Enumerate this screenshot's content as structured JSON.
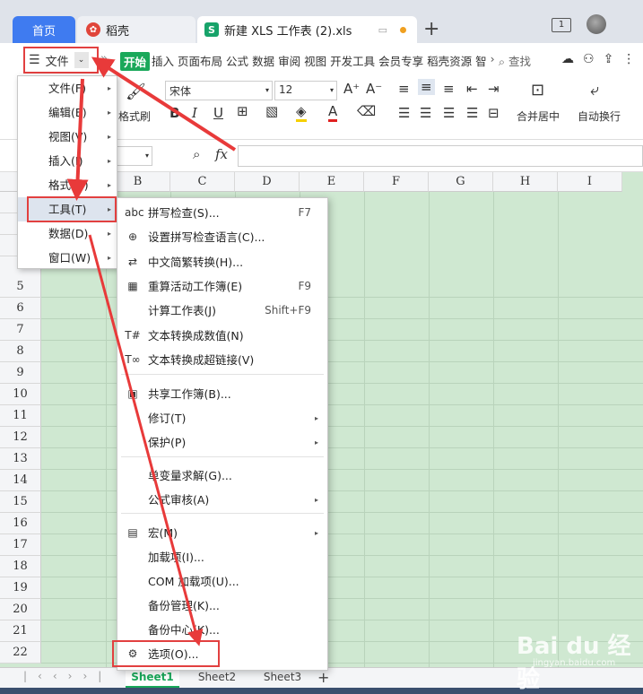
{
  "tabs": {
    "home": "首页",
    "daoke": "稻壳",
    "doc": "新建 XLS 工作表 (2).xls"
  },
  "menubar": {
    "file": "文件",
    "start": "开始",
    "tabs": [
      "插入",
      "页面布局",
      "公式",
      "数据",
      "审阅",
      "视图",
      "开发工具",
      "会员专享",
      "稻壳资源",
      "智"
    ],
    "search": "查找"
  },
  "ribbon": {
    "format_brush": "格式刷",
    "font": "宋体",
    "size": "12",
    "merge": "合并居中",
    "wrap": "自动换行"
  },
  "formula": {
    "fx": "fx"
  },
  "columns": [
    "B",
    "C",
    "D",
    "E",
    "F",
    "G",
    "H",
    "I"
  ],
  "rows": [
    "5",
    "6",
    "7",
    "8",
    "9",
    "10",
    "11",
    "12",
    "13",
    "14",
    "15",
    "16",
    "17",
    "18",
    "19",
    "20",
    "21",
    "22"
  ],
  "sheets": [
    "Sheet1",
    "Sheet2",
    "Sheet3"
  ],
  "menu1": [
    {
      "label": "文件(F)"
    },
    {
      "label": "编辑(E)"
    },
    {
      "label": "视图(V)"
    },
    {
      "label": "插入(I)"
    },
    {
      "label": "格式(O)"
    },
    {
      "label": "工具(T)"
    },
    {
      "label": "数据(D)"
    },
    {
      "label": "窗口(W)"
    }
  ],
  "menu2": [
    {
      "label": "拼写检查(S)...",
      "sc": "F7",
      "icon": "abc"
    },
    {
      "label": "设置拼写检查语言(C)...",
      "sc": "",
      "icon": "⊕"
    },
    {
      "label": "中文简繁转换(H)...",
      "sc": "",
      "icon": "⇄"
    },
    {
      "label": "重算活动工作簿(E)",
      "sc": "F9",
      "icon": "▦"
    },
    {
      "label": "计算工作表(J)",
      "sc": "Shift+F9",
      "icon": ""
    },
    {
      "label": "文本转换成数值(N)",
      "sc": "",
      "icon": "T#"
    },
    {
      "label": "文本转换成超链接(V)",
      "sc": "",
      "icon": "T∞"
    },
    {
      "label": "共享工作簿(B)...",
      "sc": "",
      "icon": "▣"
    },
    {
      "label": "修订(T)",
      "sc": "",
      "icon": ""
    },
    {
      "label": "保护(P)",
      "sc": "",
      "icon": ""
    },
    {
      "label": "单变量求解(G)...",
      "sc": "",
      "icon": ""
    },
    {
      "label": "公式审核(A)",
      "sc": "",
      "icon": ""
    },
    {
      "label": "宏(M)",
      "sc": "",
      "icon": "▤"
    },
    {
      "label": "加载项(I)...",
      "sc": "",
      "icon": ""
    },
    {
      "label": "COM 加载项(U)...",
      "sc": "",
      "icon": ""
    },
    {
      "label": "备份管理(K)...",
      "sc": "",
      "icon": ""
    },
    {
      "label": "备份中心(K)...",
      "sc": "",
      "icon": ""
    },
    {
      "label": "选项(O)...",
      "sc": "",
      "icon": "⚙"
    }
  ],
  "watermark": {
    "main": "Bai du 经验",
    "sub": "jingyan.baidu.com"
  }
}
